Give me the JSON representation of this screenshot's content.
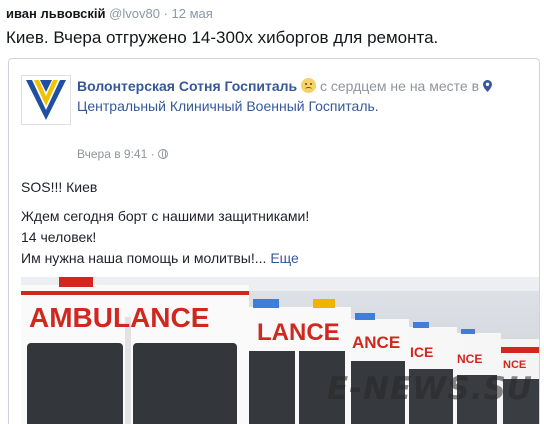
{
  "tweet": {
    "author_name": "иван львовскiй",
    "handle": "@lvov80",
    "separator": "·",
    "date": "12 мая",
    "text": "Киев. Вчера отгружено 14-300х хиборгов для ремонта."
  },
  "fb_post": {
    "page_name": "Волонтерская Сотня Госпиталь",
    "feeling_text": "с сердцем не на месте в",
    "location": "Центральный Клиничный Военный Госпиталь.",
    "timestamp": "Вчера в 9:41",
    "meta_separator": "·",
    "lines": [
      "SOS!!! Киев",
      "Ждем сегодня борт с нашими защитниками!",
      "14 человек!",
      "Им нужна наша помощь и молитвы!..."
    ],
    "see_more": "Еще",
    "photo": {
      "van_labels": [
        "AMBULANCE",
        "LANCE",
        "ANCE",
        "ICE",
        "NCE",
        "NCE"
      ],
      "watermark": "E-NEWS.SU"
    }
  },
  "icons": [
    "emoji-sad-icon",
    "location-pin-icon",
    "globe-icon"
  ],
  "colors": {
    "fb_link": "#365899",
    "tweet_meta": "#8899a6",
    "ambulance_red": "#d0271f",
    "logo_blue": "#1f4fa0",
    "logo_yellow": "#f2c200"
  }
}
